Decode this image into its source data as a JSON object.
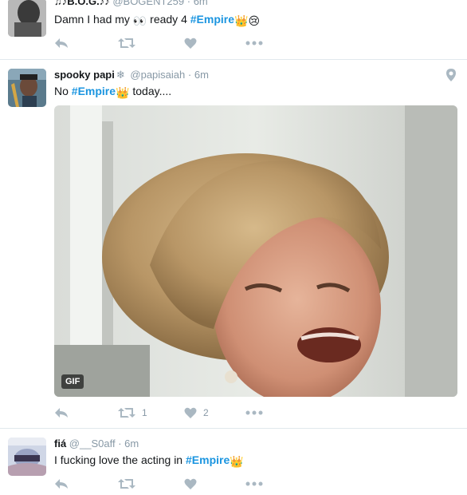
{
  "tweets": [
    {
      "name": "♫♪B.O.G.♪♪",
      "handle": "@BOGENT259",
      "dot": "·",
      "time": "6m",
      "text_before": "Damn I had my ",
      "text_mid": " ready 4 ",
      "hashtag": "#Empire",
      "emoji_eyes": "👀",
      "emoji_crown": "👑",
      "emoji_cry": "😢",
      "retweets": "",
      "likes": ""
    },
    {
      "name": "spooky papi",
      "name_emoji": "❄",
      "handle": "@papisaiah",
      "dot": "·",
      "time": "6m",
      "text_before": "No ",
      "hashtag": "#Empire",
      "emoji_crown": "👑",
      "text_after": " today....",
      "media_badge": "GIF",
      "retweets": "1",
      "likes": "2"
    },
    {
      "name": "fiá",
      "handle": "@__S0aff",
      "dot": "·",
      "time": "6m",
      "text_before": "I fucking love the acting in ",
      "hashtag": "#Empire",
      "emoji_crown": "👑",
      "retweets": "",
      "likes": ""
    }
  ],
  "icons": {
    "reply": "reply-icon",
    "retweet": "retweet-icon",
    "like": "heart-icon",
    "more": "more-icon",
    "location": "location-pin-icon"
  },
  "colors": {
    "hashtag": "#1b95e0",
    "action_icon": "#aab8c2",
    "meta_text": "#8899a6",
    "divider": "#e1e8ed"
  }
}
